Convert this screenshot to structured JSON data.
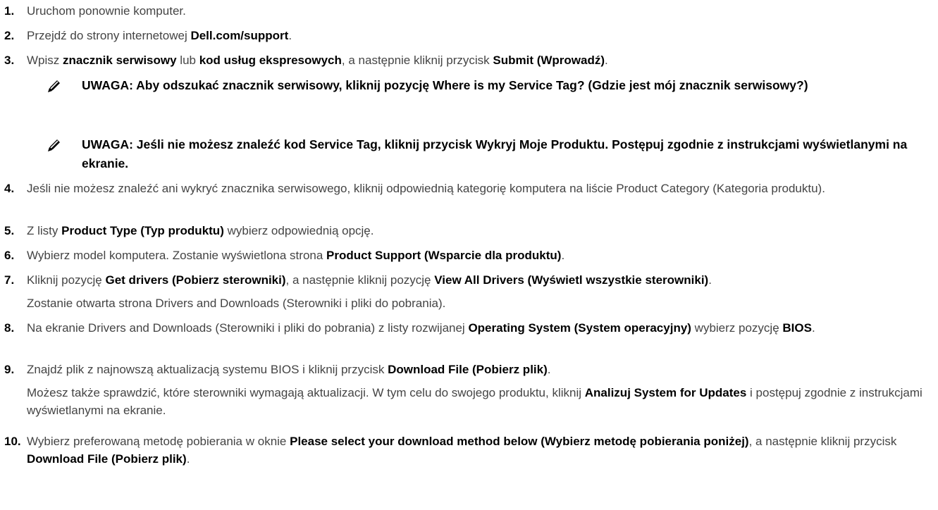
{
  "steps": [
    {
      "num": "1.",
      "parts": [
        "Uruchom ponownie komputer."
      ]
    },
    {
      "num": "2.",
      "parts": [
        "Przejdź do strony internetowej ",
        {
          "b": "Dell.com/support"
        },
        "."
      ]
    },
    {
      "num": "3.",
      "parts": [
        "Wpisz ",
        {
          "b": "znacznik serwisowy"
        },
        " lub ",
        {
          "b": "kod usług ekspresowych"
        },
        ", a następnie kliknij przycisk ",
        {
          "b": "Submit (Wprowadź)"
        },
        "."
      ]
    },
    {
      "num": "4.",
      "parts": [
        "Jeśli nie możesz znaleźć ani wykryć znacznika serwisowego, kliknij odpowiednią kategorię komputera na liście Product Category (Kategoria produktu)."
      ]
    },
    {
      "num": "5.",
      "parts": [
        "Z listy ",
        {
          "b": "Product Type (Typ produktu)"
        },
        " wybierz odpowiednią opcję."
      ]
    },
    {
      "num": "6.",
      "parts": [
        "Wybierz model komputera. Zostanie wyświetlona strona ",
        {
          "b": "Product Support (Wsparcie dla produktu)"
        },
        "."
      ]
    },
    {
      "num": "7.",
      "parts": [
        "Kliknij pozycję ",
        {
          "b": "Get drivers (Pobierz sterowniki)"
        },
        ", a następnie kliknij pozycję ",
        {
          "b": "View All Drivers (Wyświetl wszystkie sterowniki)"
        },
        "."
      ]
    },
    {
      "num": "8.",
      "parts": [
        "Na ekranie Drivers and Downloads (Sterowniki i pliki do pobrania) z listy rozwijanej ",
        {
          "b": "Operating System (System operacyjny)"
        },
        " wybierz pozycję ",
        {
          "b": "BIOS"
        },
        "."
      ]
    },
    {
      "num": "9.",
      "parts": [
        "Znajdź plik z najnowszą aktualizacją systemu BIOS i kliknij przycisk ",
        {
          "b": "Download File (Pobierz plik)"
        },
        "."
      ]
    },
    {
      "num": "10.",
      "parts": [
        "Wybierz preferowaną metodę pobierania w oknie ",
        {
          "b": "Please select your download method below (Wybierz metodę pobierania poniżej)"
        },
        ", a następnie kliknij przycisk ",
        {
          "b": "Download File (Pobierz plik)"
        },
        "."
      ]
    }
  ],
  "notes": [
    {
      "icon": "pencil-note-icon",
      "text": "UWAGA: Aby odszukać znacznik serwisowy, kliknij pozycję Where is my Service Tag? (Gdzie jest mój znacznik serwisowy?)"
    },
    {
      "icon": "pencil-note-icon",
      "text": "UWAGA: Jeśli nie możesz znaleźć kod Service Tag, kliknij przycisk Wykryj Moje Produktu. Postępuj zgodnie z instrukcjami wyświetlanymi na ekranie."
    }
  ],
  "paras": {
    "after_step7": [
      "Zostanie otwarta strona Drivers and Downloads (Sterowniki i pliki do pobrania)."
    ],
    "after_step9": [
      "Możesz także sprawdzić, które sterowniki wymagają aktualizacji. W tym celu do swojego produktu, kliknij ",
      {
        "b": "Analizuj System for Updates"
      },
      " i postępuj zgodnie z instrukcjami wyświetlanymi na ekranie."
    ]
  }
}
